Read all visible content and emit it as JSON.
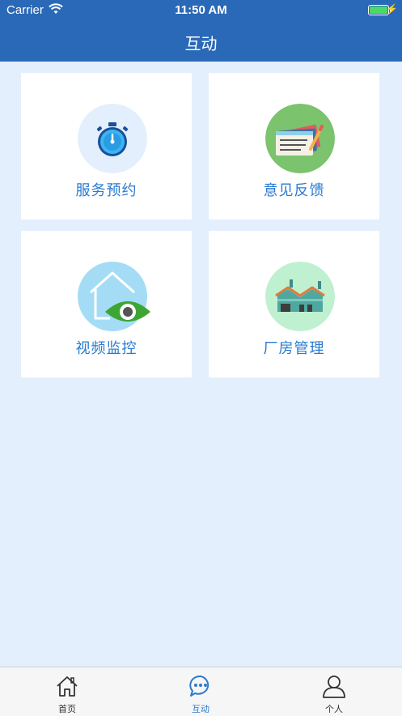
{
  "status": {
    "carrier": "Carrier",
    "time": "11:50 AM"
  },
  "nav": {
    "title": "互动"
  },
  "cards": [
    {
      "label": "服务预约",
      "icon": "stopwatch-icon"
    },
    {
      "label": "意见反馈",
      "icon": "notes-pencil-icon"
    },
    {
      "label": "视频监控",
      "icon": "house-eye-icon"
    },
    {
      "label": "厂房管理",
      "icon": "factory-icon"
    }
  ],
  "tabs": [
    {
      "label": "首页",
      "icon": "home-icon",
      "active": false
    },
    {
      "label": "互动",
      "icon": "chat-bubble-icon",
      "active": true
    },
    {
      "label": "个人",
      "icon": "person-icon",
      "active": false
    }
  ],
  "colors": {
    "primary": "#2a69b7",
    "background": "#e3effc",
    "label": "#2a7bd0",
    "tab_active": "#2a7bd0",
    "tab_inactive": "#333333"
  }
}
